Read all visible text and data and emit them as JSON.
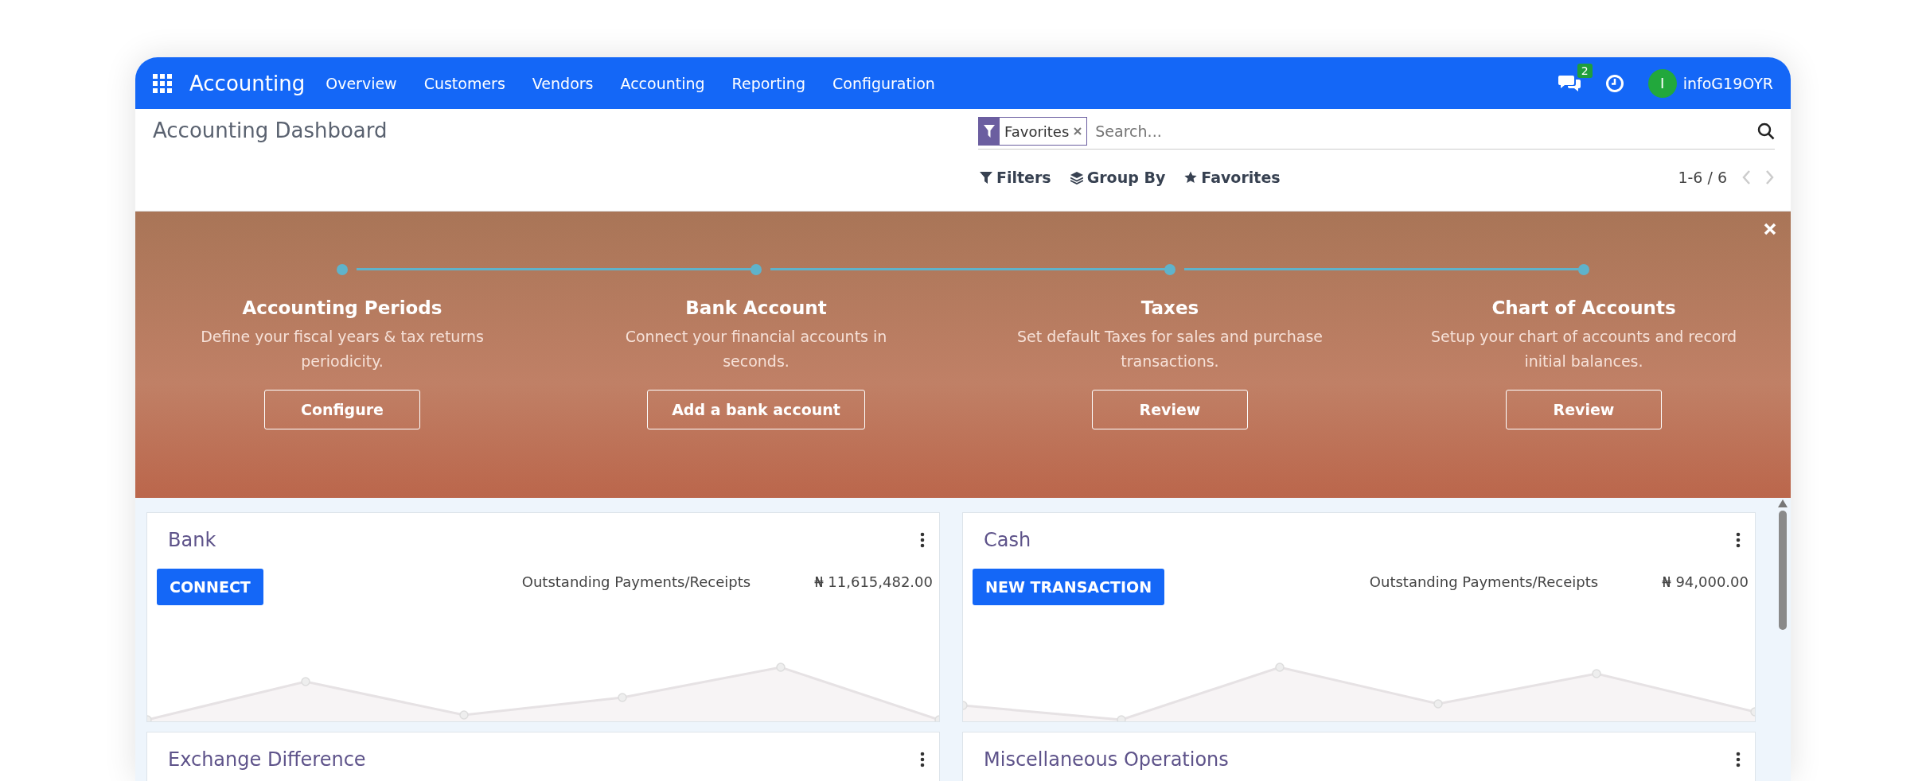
{
  "navbar": {
    "brand": "Accounting",
    "menu": [
      "Overview",
      "Customers",
      "Vendors",
      "Accounting",
      "Reporting",
      "Configuration"
    ],
    "messages_badge": "2",
    "user": {
      "initial": "I",
      "name": "infoG19OYR"
    }
  },
  "control_panel": {
    "title": "Accounting Dashboard",
    "search": {
      "facet": "Favorites",
      "placeholder": "Search..."
    },
    "filters": [
      {
        "kind": "filter",
        "label": "Filters"
      },
      {
        "kind": "group",
        "label": "Group By"
      },
      {
        "kind": "favorite",
        "label": "Favorites"
      }
    ],
    "pager": "1-6 / 6"
  },
  "onboarding": {
    "steps": [
      {
        "title": "Accounting Periods",
        "description": "Define your fiscal years & tax returns periodicity.",
        "button": "Configure"
      },
      {
        "title": "Bank Account",
        "description": "Connect your financial accounts in seconds.",
        "button": "Add a bank account"
      },
      {
        "title": "Taxes",
        "description": "Set default Taxes for sales and purchase transactions.",
        "button": "Review"
      },
      {
        "title": "Chart of Accounts",
        "description": "Setup your chart of accounts and record initial balances.",
        "button": "Review"
      }
    ]
  },
  "journals": [
    {
      "title": "Bank",
      "action": "CONNECT",
      "label": "Outstanding Payments/Receipts",
      "amount": "₦ 11,615,482.00"
    },
    {
      "title": "Cash",
      "action": "NEW TRANSACTION",
      "label": "Outstanding Payments/Receipts",
      "amount": "₦ 94,000.00"
    },
    {
      "title": "Exchange Difference"
    },
    {
      "title": "Miscellaneous Operations"
    }
  ]
}
